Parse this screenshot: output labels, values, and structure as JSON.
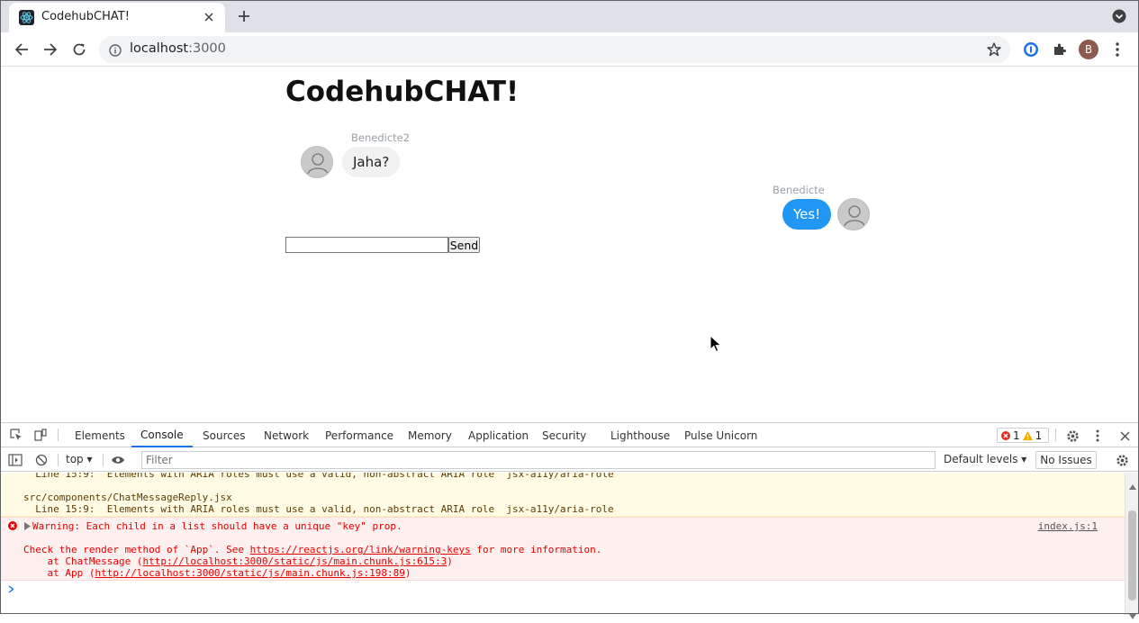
{
  "browser": {
    "tab_title": "CodehubCHAT!",
    "url_host": "localhost",
    "url_port": ":3000",
    "profile_initial": "B"
  },
  "app": {
    "title": "CodehubCHAT!",
    "messages": [
      {
        "sender": "Benedicte2",
        "text": "Jaha?",
        "side": "left"
      },
      {
        "sender": "Benedicte",
        "text": "Yes!",
        "side": "right"
      }
    ],
    "input_value": "",
    "send_label": "Send",
    "colors": {
      "mine_bubble": "#2196f3",
      "other_bubble": "#f1f1f1"
    }
  },
  "devtools": {
    "tabs": [
      "Elements",
      "Console",
      "Sources",
      "Network",
      "Performance",
      "Memory",
      "Application",
      "Security",
      "Lighthouse",
      "Pulse Unicorn"
    ],
    "active_tab": "Console",
    "error_count": "1",
    "warning_count": "1",
    "context": "top",
    "filter_placeholder": "Filter",
    "levels": "Default levels",
    "issues": "No Issues",
    "console": {
      "warn_line1": "  Line 15:9:  Elements with ARIA roles must use a valid, non-abstract ARIA role  jsx-a11y/aria-role",
      "warn_line2": "src/components/ChatMessageReply.jsx",
      "warn_line3": "  Line 15:9:  Elements with ARIA roles must use a valid, non-abstract ARIA role  jsx-a11y/aria-role",
      "err_line1": "Warning: Each child in a list should have a unique \"key\" prop.",
      "err_source": "index.js:1",
      "err_line2_pre": "Check the render method of `App`. See ",
      "err_line2_link": "https://reactjs.org/link/warning-keys",
      "err_line2_post": " for more information.",
      "err_line3_pre": "    at ChatMessage (",
      "err_line3_link": "http://localhost:3000/static/js/main.chunk.js:615:3",
      "err_line3_post": ")",
      "err_line4_pre": "    at App (",
      "err_line4_link": "http://localhost:3000/static/js/main.chunk.js:198:89",
      "err_line4_post": ")"
    }
  }
}
